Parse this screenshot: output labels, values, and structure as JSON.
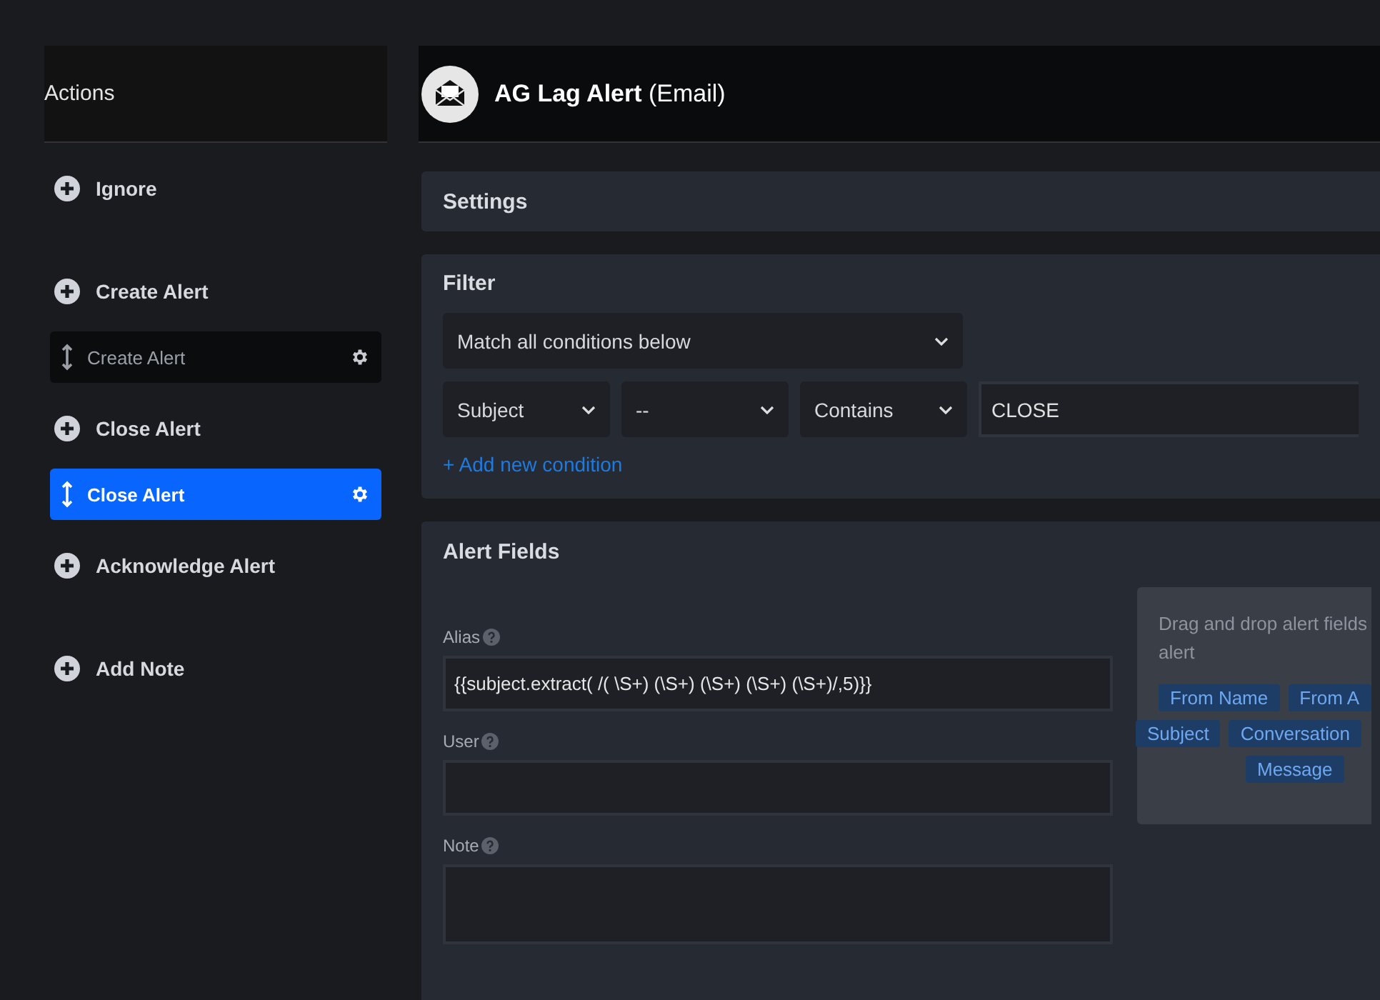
{
  "sidebar": {
    "title": "Actions",
    "actions": [
      {
        "label": "Ignore"
      },
      {
        "label": "Create Alert",
        "children": [
          {
            "label": "Create Alert",
            "selected": false
          }
        ]
      },
      {
        "label": "Close Alert",
        "children": [
          {
            "label": "Close Alert",
            "selected": true
          }
        ]
      },
      {
        "label": "Acknowledge Alert"
      },
      {
        "label": "Add Note"
      }
    ]
  },
  "header": {
    "title": "AG Lag Alert",
    "subtitle": "(Email)"
  },
  "settings": {
    "title": "Settings"
  },
  "filter": {
    "title": "Filter",
    "match": "Match all conditions below",
    "conditions": [
      {
        "field": "Subject",
        "operator": "--",
        "comparison": "Contains",
        "value": "CLOSE"
      }
    ],
    "add_link": "+ Add new condition"
  },
  "alert_fields": {
    "title": "Alert Fields",
    "fields": [
      {
        "label": "Alias",
        "value": "{{subject.extract( /( \\S+) (\\S+) (\\S+) (\\S+) (\\S+)/,5)}}",
        "kind": "line"
      },
      {
        "label": "User",
        "kind": "line"
      },
      {
        "label": "Note",
        "kind": "area"
      }
    ],
    "hint_lines": [
      "Drag and drop alert fields",
      "alert"
    ],
    "tag_rows": [
      [
        "From Name",
        "From A"
      ],
      [
        "Subject",
        "Conversation"
      ],
      [
        "Message"
      ]
    ]
  }
}
